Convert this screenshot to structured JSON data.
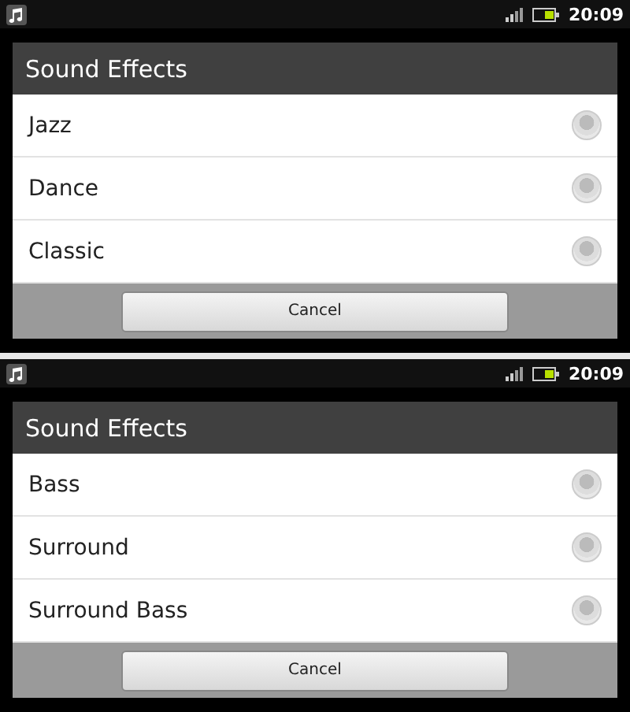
{
  "screens": [
    {
      "status_bar": {
        "time": "20:09"
      },
      "dialog": {
        "title": "Sound Effects",
        "items": [
          {
            "label": "Jazz",
            "selected": false
          },
          {
            "label": "Dance",
            "selected": false
          },
          {
            "label": "Classic",
            "selected": false
          }
        ],
        "button": "Cancel"
      }
    },
    {
      "status_bar": {
        "time": "20:09"
      },
      "dialog": {
        "title": "Sound Effects",
        "items": [
          {
            "label": "Bass",
            "selected": false
          },
          {
            "label": "Surround",
            "selected": false
          },
          {
            "label": "Surround Bass",
            "selected": false
          }
        ],
        "button": "Cancel"
      }
    }
  ]
}
